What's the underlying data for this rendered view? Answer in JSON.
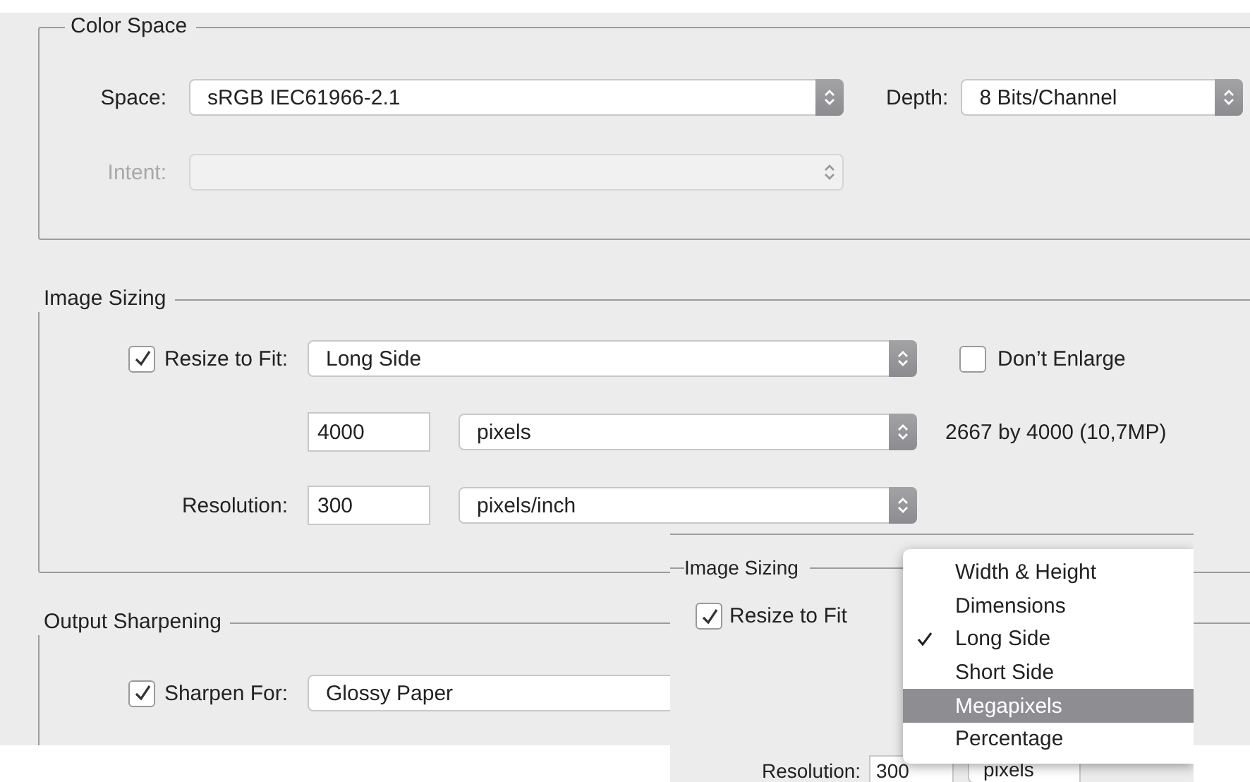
{
  "color_space": {
    "legend": "Color Space",
    "space": {
      "label": "Space:",
      "value": "sRGB IEC61966-2.1"
    },
    "depth": {
      "label": "Depth:",
      "value": "8 Bits/Channel"
    },
    "intent": {
      "label": "Intent:",
      "disabled": true
    }
  },
  "image_sizing": {
    "legend": "Image Sizing",
    "resize_to_fit": {
      "label": "Resize to Fit:",
      "checked": true,
      "value": "Long Side"
    },
    "dont_enlarge": {
      "label": "Don’t Enlarge",
      "checked": false
    },
    "size": {
      "value": "4000",
      "unit": "pixels"
    },
    "result": "2667 by 4000 (10,7MP)",
    "resolution": {
      "label": "Resolution:",
      "value": "300",
      "unit": "pixels/inch"
    }
  },
  "output_sharpening": {
    "legend": "Output Sharpening",
    "sharpen_for": {
      "label": "Sharpen For:",
      "checked": true,
      "value": "Glossy Paper"
    }
  },
  "inset": {
    "legend": "Image Sizing",
    "resize_to_fit": {
      "label": "Resize to Fit",
      "checked": true
    },
    "menu": [
      {
        "label": "Width & Height",
        "checked": false,
        "selected": false
      },
      {
        "label": "Dimensions",
        "checked": false,
        "selected": false
      },
      {
        "label": "Long Side",
        "checked": true,
        "selected": false
      },
      {
        "label": "Short Side",
        "checked": false,
        "selected": false
      },
      {
        "label": "Megapixels",
        "checked": false,
        "selected": true
      },
      {
        "label": "Percentage",
        "checked": false,
        "selected": false
      }
    ],
    "resolution": {
      "label": "Resolution:",
      "value": "300",
      "unit": "pixels"
    }
  }
}
